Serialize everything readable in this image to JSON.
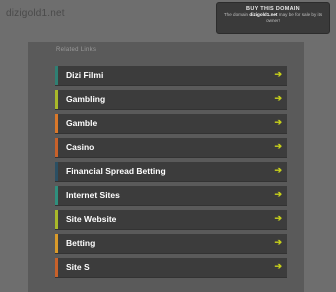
{
  "header": {
    "domain": "dizigold1.net"
  },
  "buy_box": {
    "title": "BUY THIS DOMAIN",
    "line1_prefix": "The domain",
    "line1_domain": "dizigold1.net",
    "line1_suffix": "may be for sale by its",
    "line2": "owner!"
  },
  "related": {
    "title": "Related Links",
    "links": [
      {
        "label": "Dizi Filmi",
        "color": "#2f7f73"
      },
      {
        "label": "Gambling",
        "color": "#a9b92a"
      },
      {
        "label": "Gamble",
        "color": "#d9782a"
      },
      {
        "label": "Casino",
        "color": "#c8612a"
      },
      {
        "label": "Financial Spread Betting",
        "color": "#2b4f63"
      },
      {
        "label": "Internet Sites",
        "color": "#2f8f7d"
      },
      {
        "label": "Site Website",
        "color": "#a9b92a"
      },
      {
        "label": "Betting",
        "color": "#d99a2a"
      },
      {
        "label": "Site S",
        "color": "#c8612a"
      }
    ],
    "arrow_icon": "arrow-right-icon"
  }
}
